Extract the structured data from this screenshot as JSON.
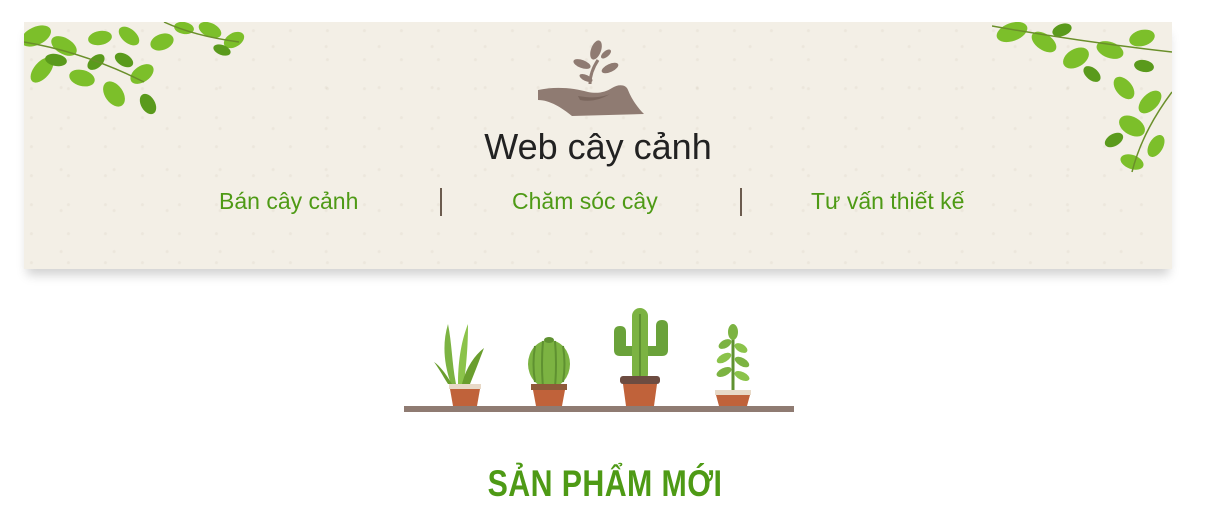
{
  "site": {
    "title": "Web cây cảnh"
  },
  "nav": {
    "items": [
      {
        "label": "Bán cây cảnh"
      },
      {
        "label": "Chăm sóc cây"
      },
      {
        "label": "Tư vấn thiết kế"
      }
    ]
  },
  "section": {
    "title": "SẢN PHẨM MỚI"
  },
  "icons": {
    "logo": "hand-sprout-icon",
    "decor_left": "leaves-decoration",
    "decor_right": "leaves-decoration",
    "plants": "potted-plants-illustration"
  },
  "colors": {
    "accent_green": "#4e9a15",
    "header_bg": "#f3efe6",
    "title_text": "#222222",
    "separator": "#6b5b4e"
  }
}
